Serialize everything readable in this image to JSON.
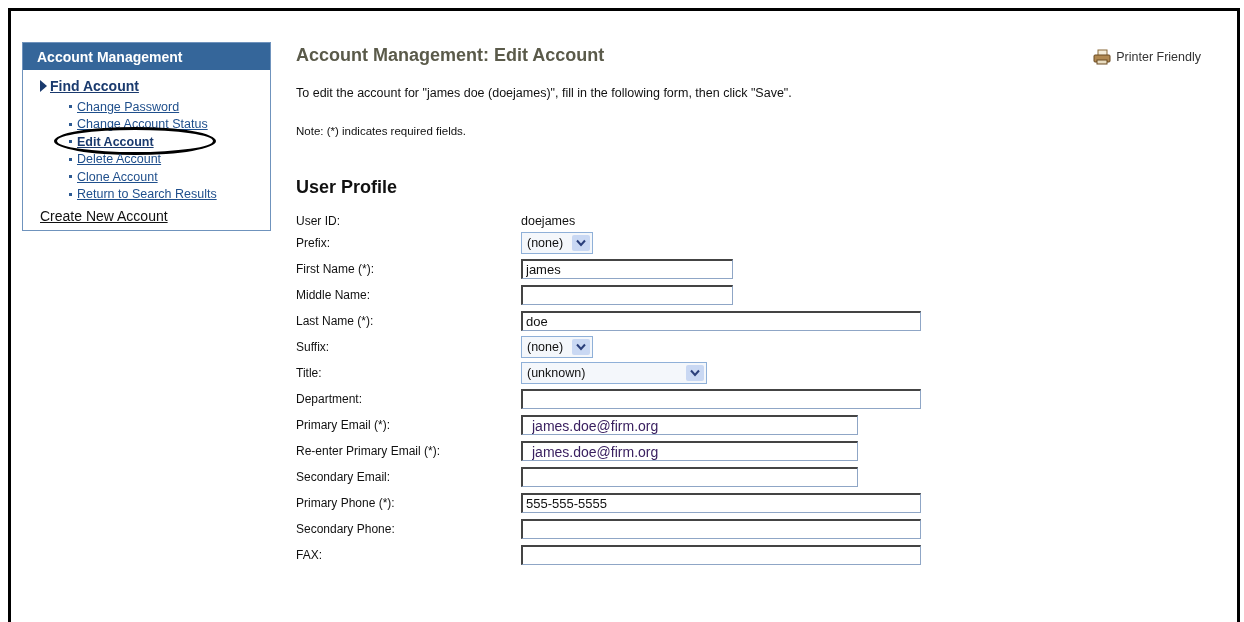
{
  "sidebar": {
    "title": "Account Management",
    "section": {
      "label": "Find Account"
    },
    "items": [
      {
        "label": "Change Password",
        "selected": false,
        "circled": false
      },
      {
        "label": "Change Account Status",
        "selected": false,
        "circled": false
      },
      {
        "label": "Edit Account",
        "selected": true,
        "circled": true
      },
      {
        "label": "Delete Account",
        "selected": false,
        "circled": false
      },
      {
        "label": "Clone Account",
        "selected": false,
        "circled": false
      },
      {
        "label": "Return to Search Results",
        "selected": false,
        "circled": false
      }
    ],
    "footer_link": "Create New Account"
  },
  "printer_link": "Printer Friendly",
  "page_title": "Account Management: Edit Account",
  "intro": "To edit the account for \"james doe (doejames)\", fill in the following form, then click \"Save\".",
  "note": "Note: (*) indicates required fields.",
  "section_title": "User Profile",
  "fields": [
    {
      "label": "User ID:",
      "kind": "static",
      "value": "doejames"
    },
    {
      "label": "Prefix:",
      "kind": "select",
      "value": "(none)"
    },
    {
      "label": "First Name (*):",
      "kind": "text",
      "value": "james"
    },
    {
      "label": "Middle Name:",
      "kind": "text"
    },
    {
      "label": "Last Name (*):",
      "kind": "text",
      "value": "doe"
    },
    {
      "label": "Suffix:",
      "kind": "select",
      "value": "(none)"
    },
    {
      "label": "Title:",
      "kind": "select",
      "value": "(unknown)"
    },
    {
      "label": "Department:",
      "kind": "text"
    },
    {
      "label": "Primary Email (*):",
      "kind": "email",
      "value": "james.doe@firm.org"
    },
    {
      "label": "Re-enter Primary Email (*):",
      "kind": "email",
      "value": "james.doe@firm.org"
    },
    {
      "label": "Secondary Email:",
      "kind": "text"
    },
    {
      "label": "Primary Phone (*):",
      "kind": "text",
      "value": "555-555-5555"
    },
    {
      "label": "Secondary Phone:",
      "kind": "text"
    },
    {
      "label": "FAX:",
      "kind": "text"
    }
  ]
}
